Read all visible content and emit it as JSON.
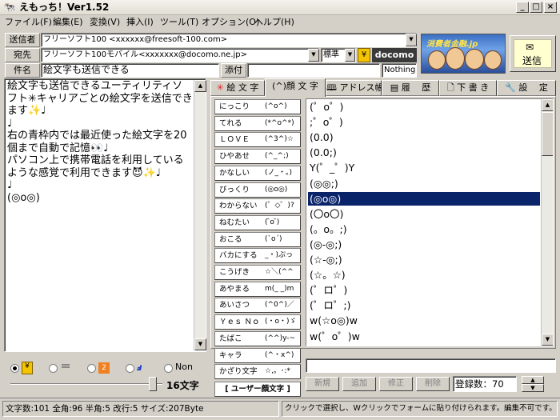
{
  "window": {
    "title": "えもっち！Ver1.52"
  },
  "menu": [
    "ファイル(F)",
    "編集(E)",
    "変換(V)",
    "挿入(I)",
    "ツール(T)",
    "オプション(O)",
    "ヘルプ(H)"
  ],
  "header": {
    "sender_label": "送信者",
    "sender_value": "フリーソフト100 <xxxxxx@freesoft-100.com>",
    "to_label": "宛先",
    "to_value": "フリーソフト100モバイル<xxxxxxx@docomo.ne.jp>",
    "std_value": "標準",
    "carrier_name": "docomo",
    "subject_label": "件名",
    "subject_value": "絵文字も送信できる",
    "attach_label": "添付",
    "attach_value": "Nothing",
    "banner_text": "消費者金融.jp",
    "send_label": "送信"
  },
  "message": {
    "body": "絵文字も送信できるユーティリティソフト✳キャリアごとの絵文字を送信できます✨♩\n♩\n右の青枠内では最近使った絵文字を20個まで自動で記憶👀♩\nパソコン上で携帯電話を利用しているような感覚で利用できます😈✨♩\n♩\n(◎o◎)"
  },
  "tabs": [
    {
      "label": "絵 文 字",
      "icon": "sun-icon"
    },
    {
      "label": "(^)顔 文 字",
      "icon": "none"
    },
    {
      "label": "アドレス帳",
      "icon": "book-icon"
    },
    {
      "label": "履　 歴",
      "icon": "history-icon"
    },
    {
      "label": "下 書 き",
      "icon": "draft-icon"
    },
    {
      "label": "設　 定",
      "icon": "wrench-icon"
    }
  ],
  "categories": [
    {
      "name": "にっこり",
      "sample": "(^o^)"
    },
    {
      "name": "てれる",
      "sample": "(*^o^*)"
    },
    {
      "name": "ＬＯＶＥ",
      "sample": "(^3^)☆"
    },
    {
      "name": "ひやあせ",
      "sample": "(^_^;)"
    },
    {
      "name": "かなしい",
      "sample": "(ノ_・。)"
    },
    {
      "name": "びっくり",
      "sample": "(◎o◎)"
    },
    {
      "name": "わからない",
      "sample": "(゜◇゜)?"
    },
    {
      "name": "ねむたい",
      "sample": "( ̄o ̄)"
    },
    {
      "name": "おこる",
      "sample": "(`o´)"
    },
    {
      "name": "バカにする",
      "sample": "_・)ぷっ"
    },
    {
      "name": "こうげき",
      "sample": "☆＼(^^"
    },
    {
      "name": "あやまる",
      "sample": "m(_ _)m"
    },
    {
      "name": "あいさつ",
      "sample": "(^0^)／"
    },
    {
      "name": "Ｙｅｓ Ｎｏ",
      "sample": "(・o・)ゞ"
    },
    {
      "name": "たばこ",
      "sample": "(^^)y-~"
    },
    {
      "name": "キャラ",
      "sample": "(^・x^)"
    },
    {
      "name": "かざり文字",
      "sample": "☆,。･:*"
    }
  ],
  "user_kaomoji_label": "[ ユーザー顔文字 ]",
  "kaomoji_list": [
    "(゜o゜)",
    ";゜o゜)",
    "(0.0)",
    "(0.0;)",
    "Y(゜_゜)Y",
    "(◎◎;)",
    "(◎o◎)",
    "(〇o〇)",
    "(。o。;)",
    "(◎-◎;)",
    "(☆-◎;)",
    "(☆。☆)",
    "(゜ロ゜)",
    "(゜ロ゜;)",
    "w(☆o◎)w",
    "w(゜o゜)w"
  ],
  "selected_index": 6,
  "radios": [
    {
      "label": "",
      "icon": "coin-icon",
      "checked": true
    },
    {
      "label": "",
      "icon": "equal-icon",
      "checked": false
    },
    {
      "label": "",
      "icon": "number-icon",
      "checked": false
    },
    {
      "label": "",
      "icon": "script-icon",
      "checked": false
    },
    {
      "label": "Non",
      "icon": "none",
      "checked": false
    }
  ],
  "char_count_label": "16文字",
  "buttons": {
    "new": "新規",
    "add": "追加",
    "edit": "修正",
    "delete": "削除"
  },
  "registered_label": "登録数：70",
  "status": {
    "left": "文字数:101 全角:96 半角:5 改行:5 サイズ:207Byte",
    "right": "クリックで選択し、Wクリックでフォームに貼り付けられます。編集不可です。"
  },
  "colors": {
    "selection": "#0a246a",
    "accent_red": "#e02020"
  }
}
